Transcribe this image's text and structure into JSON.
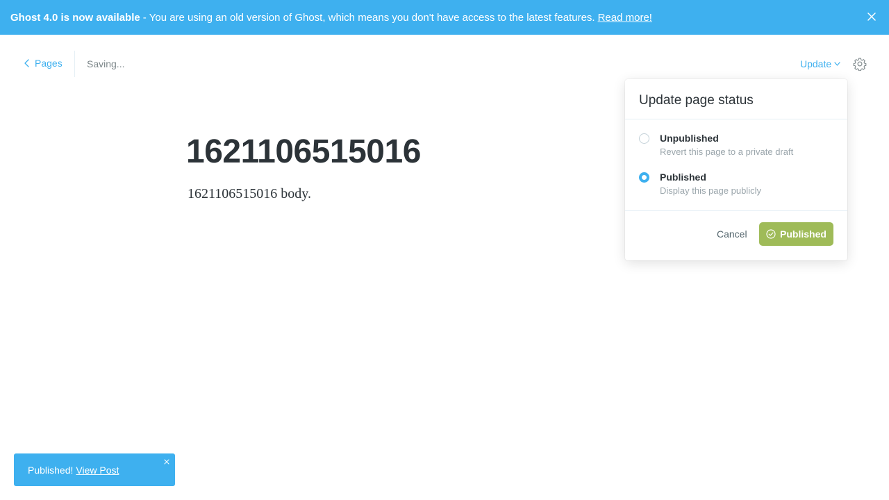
{
  "banner": {
    "title": "Ghost 4.0 is now available",
    "separator": "-",
    "message": "You are using an old version of Ghost, which means you don't have access to the latest features.",
    "link_label": "Read more!",
    "close_icon": "close-icon",
    "background_color": "#3eb0ef"
  },
  "header": {
    "back_label": "Pages",
    "status_text": "Saving...",
    "update_label": "Update",
    "settings_icon": "gear-icon"
  },
  "post": {
    "title": "1621106515016",
    "body": "1621106515016 body."
  },
  "dropdown": {
    "title": "Update page status",
    "options": [
      {
        "label": "Unpublished",
        "description": "Revert this page to a private draft",
        "selected": false
      },
      {
        "label": "Published",
        "description": "Display this page publicly",
        "selected": true
      }
    ],
    "cancel_label": "Cancel",
    "confirm_label": "Published",
    "confirm_color": "#9fbb58"
  },
  "toast": {
    "message": "Published!",
    "link_label": "View Post",
    "close_icon": "close-icon"
  }
}
